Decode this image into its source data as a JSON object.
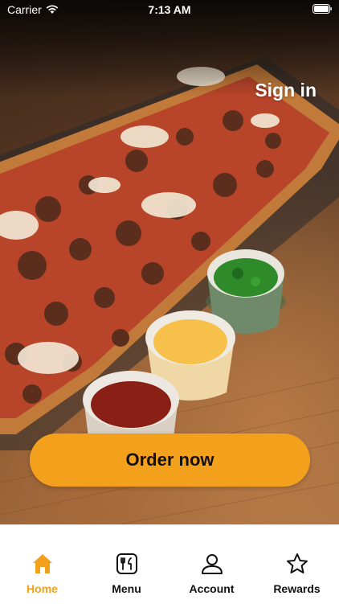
{
  "status_bar": {
    "carrier": "Carrier",
    "time": "7:13 AM"
  },
  "header": {
    "sign_in": "Sign in"
  },
  "hero": {
    "image": "pizza-with-dipping-sauces"
  },
  "main": {
    "order_button": "Order now"
  },
  "tabs": [
    {
      "label": "Home",
      "icon": "home-icon",
      "active": true
    },
    {
      "label": "Menu",
      "icon": "menu-icon",
      "active": false
    },
    {
      "label": "Account",
      "icon": "account-icon",
      "active": false
    },
    {
      "label": "Rewards",
      "icon": "rewards-icon",
      "active": false
    }
  ],
  "colors": {
    "accent": "#F3A11D",
    "tab_text": "#111111",
    "background": "#FFFFFF"
  }
}
